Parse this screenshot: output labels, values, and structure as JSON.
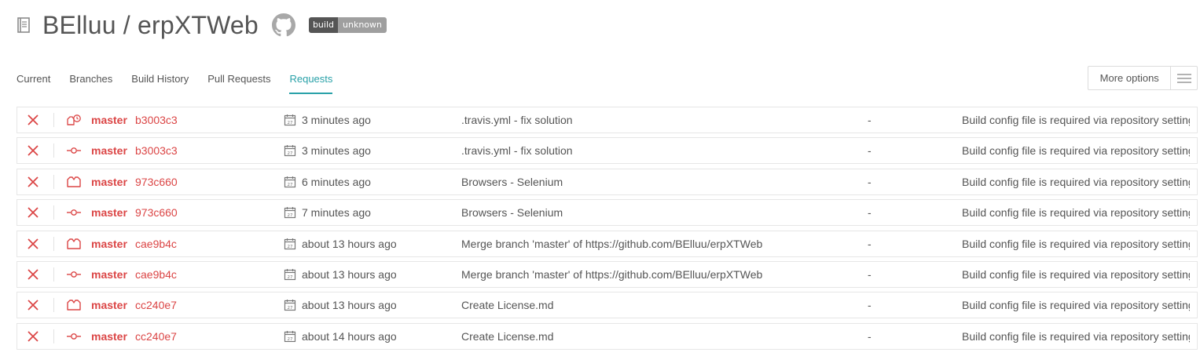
{
  "repo": {
    "title": "BElluu / erpXTWeb",
    "badge_left": "build",
    "badge_right": "unknown"
  },
  "tabs": [
    {
      "label": "Current",
      "active": false
    },
    {
      "label": "Branches",
      "active": false
    },
    {
      "label": "Build History",
      "active": false
    },
    {
      "label": "Pull Requests",
      "active": false
    },
    {
      "label": "Requests",
      "active": true
    }
  ],
  "more_options": "More options",
  "colors": {
    "error": "#db4545",
    "accent": "#29a1a8",
    "text": "#555555"
  },
  "requests": [
    {
      "status": "x-icon",
      "type": "cron-icon",
      "branch": "master",
      "commit": "b3003c3",
      "time": "3 minutes ago",
      "message": ".travis.yml - fix solution",
      "dash": "-",
      "result": "Build config file is required via repository settings"
    },
    {
      "status": "x-icon",
      "type": "push-icon",
      "branch": "master",
      "commit": "b3003c3",
      "time": "3 minutes ago",
      "message": ".travis.yml - fix solution",
      "dash": "-",
      "result": "Build config file is required via repository settings"
    },
    {
      "status": "x-icon",
      "type": "api-icon",
      "branch": "master",
      "commit": "973c660",
      "time": "6 minutes ago",
      "message": "Browsers - Selenium",
      "dash": "-",
      "result": "Build config file is required via repository settings"
    },
    {
      "status": "x-icon",
      "type": "push-icon",
      "branch": "master",
      "commit": "973c660",
      "time": "7 minutes ago",
      "message": "Browsers - Selenium",
      "dash": "-",
      "result": "Build config file is required via repository settings"
    },
    {
      "status": "x-icon",
      "type": "api-icon",
      "branch": "master",
      "commit": "cae9b4c",
      "time": "about 13 hours ago",
      "message": "Merge branch 'master' of https://github.com/BElluu/erpXTWeb",
      "dash": "-",
      "result": "Build config file is required via repository settings"
    },
    {
      "status": "x-icon",
      "type": "push-icon",
      "branch": "master",
      "commit": "cae9b4c",
      "time": "about 13 hours ago",
      "message": "Merge branch 'master' of https://github.com/BElluu/erpXTWeb",
      "dash": "-",
      "result": "Build config file is required via repository settings"
    },
    {
      "status": "x-icon",
      "type": "api-icon",
      "branch": "master",
      "commit": "cc240e7",
      "time": "about 13 hours ago",
      "message": "Create License.md",
      "dash": "-",
      "result": "Build config file is required via repository settings"
    },
    {
      "status": "x-icon",
      "type": "push-icon",
      "branch": "master",
      "commit": "cc240e7",
      "time": "about 14 hours ago",
      "message": "Create License.md",
      "dash": "-",
      "result": "Build config file is required via repository settings"
    }
  ]
}
